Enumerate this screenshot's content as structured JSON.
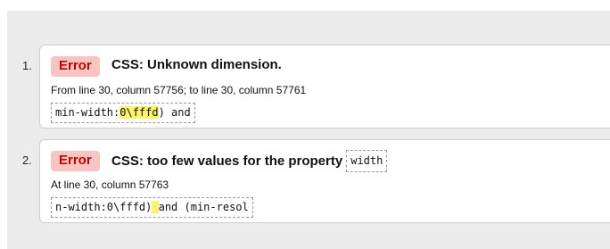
{
  "messages": [
    {
      "number": "1.",
      "type": "Error",
      "title": "CSS: Unknown dimension.",
      "location": "From line 30, column 57756; to line 30, column 57761",
      "code_before": "min-width:",
      "code_highlight": "0\\fffd",
      "code_after": ") and"
    },
    {
      "number": "2.",
      "type": "Error",
      "title": "CSS: too few values for the property",
      "title_code": "width",
      "location": "At line 30, column 57763",
      "code_before": "n-width:0\\fffd)",
      "code_highlight": " ",
      "code_after": "and (min-resol"
    }
  ],
  "colors": {
    "badge_bg": "#f8c6c2",
    "badge_text": "#c00000",
    "highlight": "#fff36a",
    "panel_bg": "#ececec"
  }
}
